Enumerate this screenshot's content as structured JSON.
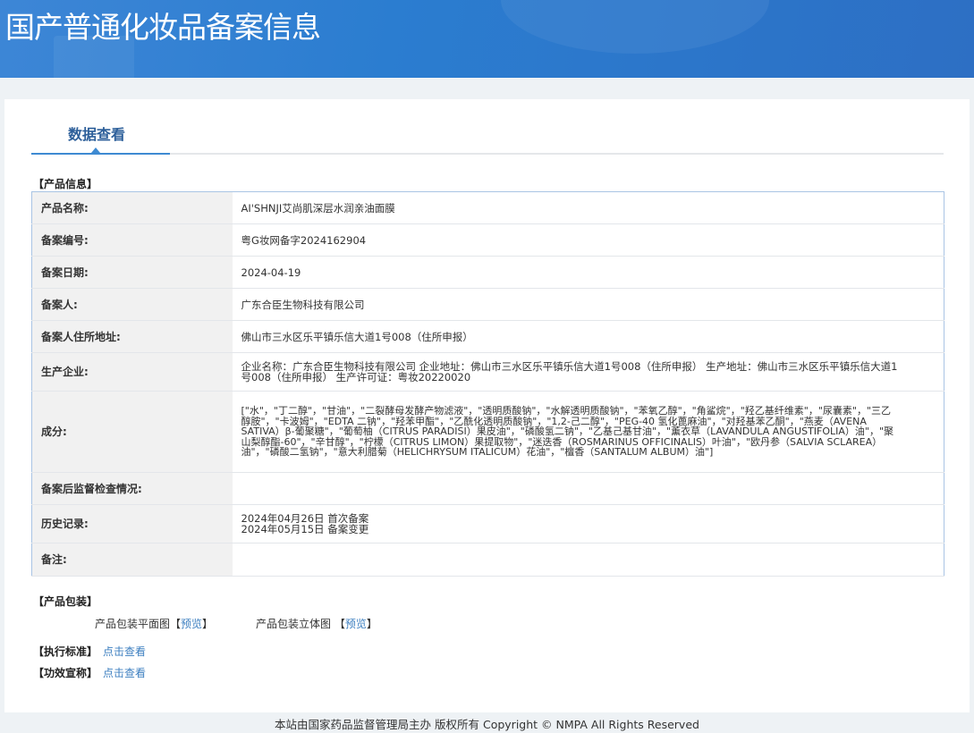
{
  "header": {
    "title": "国产普通化妆品备案信息"
  },
  "tab": {
    "label": "数据查看"
  },
  "product_info": {
    "section_title": "【产品信息】",
    "rows": [
      {
        "label": "产品名称:",
        "value": "AI'SHNJI艾尚肌深层水润亲油面膜"
      },
      {
        "label": "备案编号:",
        "value": "粤G妆网备字2024162904"
      },
      {
        "label": "备案日期:",
        "value": "2024-04-19"
      },
      {
        "label": "备案人:",
        "value": "广东合臣生物科技有限公司"
      },
      {
        "label": "备案人住所地址:",
        "value": "佛山市三水区乐平镇乐信大道1号008（住所申报）"
      },
      {
        "label": "生产企业:",
        "value": "企业名称：广东合臣生物科技有限公司 企业地址：佛山市三水区乐平镇乐信大道1号008（住所申报） 生产地址：佛山市三水区乐平镇乐信大道1号008（住所申报） 生产许可证：粤妆20220020"
      },
      {
        "label": "成分:",
        "value": "[\"水\"，\"丁二醇\"，\"甘油\"，\"二裂酵母发酵产物滤液\"，\"透明质酸钠\"，\"水解透明质酸钠\"，\"苯氧乙醇\"，\"角鲨烷\"，\"羟乙基纤维素\"，\"尿囊素\"，\"三乙醇胺\"，\"卡波姆\"，\"EDTA 二钠\"，\"羟苯甲酯\"，\"乙酰化透明质酸钠\"，\"1,2-己二醇\"，\"PEG-40 氢化蓖麻油\"，\"对羟基苯乙酮\"，\"燕麦（AVENA SATIVA）β-葡聚糖\"，\"葡萄柚（CITRUS PARADISI）果皮油\"，\"磷酸氢二钠\"，\"乙基己基甘油\"，\"薰衣草（LAVANDULA ANGUSTIFOLIA）油\"，\"聚山梨醇酯-60\"，\"辛甘醇\"，\"柠檬（CITRUS LIMON）果提取物\"，\"迷迭香（ROSMARINUS OFFICINALIS）叶油\"，\"欧丹参（SALVIA SCLAREA）油\"，\"磷酸二氢钠\"，\"意大利腊菊（HELICHRYSUM ITALICUM）花油\"，\"檀香（SANTALUM ALBUM）油\"]"
      },
      {
        "label": "备案后监督检查情况:",
        "value": ""
      },
      {
        "label": "历史记录:",
        "value": "",
        "history": [
          "2024年04月26日 首次备案",
          "2024年05月15日 备案变更"
        ]
      },
      {
        "label": "备注:",
        "value": ""
      }
    ]
  },
  "packaging": {
    "section_title": "【产品包装】",
    "flat_label": "产品包装平面图",
    "flat_link": "预览",
    "solid_label": "产品包装立体图",
    "solid_link": "预览"
  },
  "standard": {
    "label": "【执行标准】",
    "link": "点击查看"
  },
  "efficacy": {
    "label": "【功效宣称】",
    "link": "点击查看"
  },
  "footer": {
    "text": "本站由国家药品监督管理局主办 版权所有 Copyright © NMPA All Rights Reserved"
  }
}
